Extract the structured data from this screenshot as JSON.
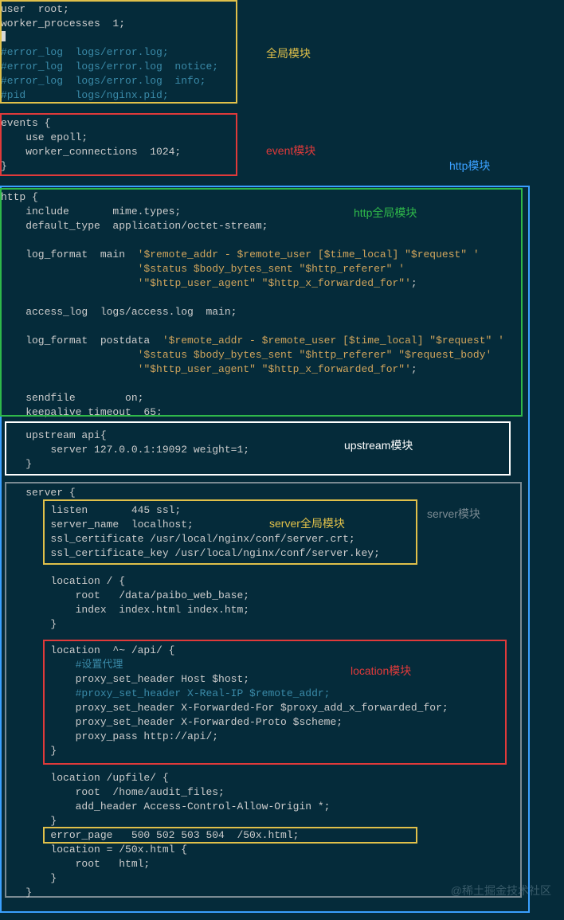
{
  "labels": {
    "global": "全局模块",
    "event": "event模块",
    "http": "http模块",
    "httpg": "http全局模块",
    "upstream": "upstream模块",
    "server": "server模块",
    "serverg": "server全局模块",
    "location": "location模块"
  },
  "watermark": "@稀土掘金技术社区",
  "global_block": [
    {
      "t": "act",
      "s": "user  root;"
    },
    {
      "t": "act",
      "s": "worker_processes  1;"
    },
    {
      "t": "act",
      "s": ""
    },
    {
      "t": "cmt",
      "s": "#error_log  logs/error.log;"
    },
    {
      "t": "cmt",
      "s": "#error_log  logs/error.log  notice;"
    },
    {
      "t": "cmt",
      "s": "#error_log  logs/error.log  info;"
    },
    {
      "t": "cmt",
      "s": "#pid        logs/nginx.pid;"
    }
  ],
  "event_block": [
    {
      "t": "act",
      "s": "events {"
    },
    {
      "t": "act",
      "s": "    use epoll;"
    },
    {
      "t": "act",
      "s": "    worker_connections  1024;"
    },
    {
      "t": "act",
      "s": "}"
    }
  ],
  "httpg_block": [
    {
      "t": "act",
      "s": "http {"
    },
    {
      "t": "act",
      "s": "    include       mime.types;"
    },
    {
      "t": "act",
      "s": "    default_type  application/octet-stream;"
    },
    {
      "t": "act",
      "s": ""
    },
    {
      "t": "mix",
      "s": "    log_format  main  ",
      "q": "'$remote_addr - $remote_user [$time_local] \"$request\" '"
    },
    {
      "t": "str",
      "s": "                      '$status $body_bytes_sent \"$http_referer\" '"
    },
    {
      "t": "mix",
      "s": "                      ",
      "q": "'\"$http_user_agent\" \"$http_x_forwarded_for\"'",
      "tail": ";"
    },
    {
      "t": "act",
      "s": ""
    },
    {
      "t": "act",
      "s": "    access_log  logs/access.log  main;"
    },
    {
      "t": "act",
      "s": ""
    },
    {
      "t": "mix",
      "s": "    log_format  postdata  ",
      "q": "'$remote_addr - $remote_user [$time_local] \"$request\" '"
    },
    {
      "t": "str",
      "s": "                      '$status $body_bytes_sent \"$http_referer\" \"$request_body'"
    },
    {
      "t": "mix",
      "s": "                      ",
      "q": "'\"$http_user_agent\" \"$http_x_forwarded_for\"'",
      "tail": ";"
    },
    {
      "t": "act",
      "s": ""
    },
    {
      "t": "act",
      "s": "    sendfile        on;"
    },
    {
      "t": "act",
      "s": "    keepalive_timeout  65;"
    }
  ],
  "upstream_block": [
    {
      "t": "act",
      "s": "    upstream api{"
    },
    {
      "t": "act",
      "s": "        server 127.0.0.1:19092 weight=1;"
    },
    {
      "t": "act",
      "s": "    }"
    }
  ],
  "server_head": [
    {
      "t": "act",
      "s": "    server {"
    }
  ],
  "serverg_block": [
    {
      "t": "act",
      "s": "        listen       445 ssl;"
    },
    {
      "t": "act",
      "s": "        server_name  localhost;"
    },
    {
      "t": "act",
      "s": "        ssl_certificate /usr/local/nginx/conf/server.crt;"
    },
    {
      "t": "act",
      "s": "        ssl_certificate_key /usr/local/nginx/conf/server.key;"
    }
  ],
  "loc_root_block": [
    {
      "t": "act",
      "s": "        location / {"
    },
    {
      "t": "act",
      "s": "            root   /data/paibo_web_base;"
    },
    {
      "t": "act",
      "s": "            index  index.html index.htm;"
    },
    {
      "t": "act",
      "s": "        }"
    }
  ],
  "location_block": [
    {
      "t": "act",
      "s": "        location  ^~ /api/ {"
    },
    {
      "t": "cmt",
      "s": "            #设置代理"
    },
    {
      "t": "act",
      "s": "            proxy_set_header Host $host;"
    },
    {
      "t": "cmt",
      "s": "            #proxy_set_header X-Real-IP $remote_addr;"
    },
    {
      "t": "act",
      "s": "            proxy_set_header X-Forwarded-For $proxy_add_x_forwarded_for;"
    },
    {
      "t": "act",
      "s": "            proxy_set_header X-Forwarded-Proto $scheme;"
    },
    {
      "t": "act",
      "s": "            proxy_pass http://api/;"
    },
    {
      "t": "act",
      "s": "        }"
    }
  ],
  "loc_upfile_block": [
    {
      "t": "act",
      "s": "        location /upfile/ {"
    },
    {
      "t": "act",
      "s": "            root  /home/audit_files;"
    },
    {
      "t": "act",
      "s": "            add_header Access-Control-Allow-Origin *;"
    },
    {
      "t": "act",
      "s": "        }"
    }
  ],
  "error_page_line": [
    {
      "t": "act",
      "s": "        error_page   500 502 503 504  /50x.html;"
    }
  ],
  "loc_50x_block": [
    {
      "t": "act",
      "s": "        location = /50x.html {"
    },
    {
      "t": "act",
      "s": "            root   html;"
    },
    {
      "t": "act",
      "s": "        }"
    },
    {
      "t": "act",
      "s": "    }"
    }
  ]
}
